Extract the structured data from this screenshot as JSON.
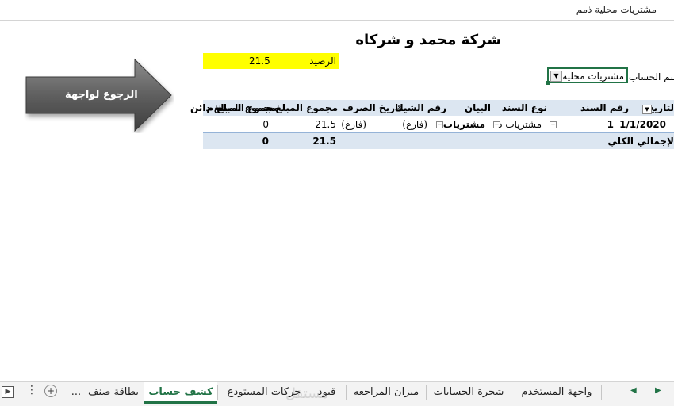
{
  "formula_bar": {
    "text": "مشتريات محلية ذمم"
  },
  "header": {
    "company_title": "شركة محمد و شركاه"
  },
  "balance": {
    "label": "الرصيد",
    "value": "21.5"
  },
  "nav_button": {
    "label": "الرجوع لواجهة"
  },
  "filter": {
    "label": "سم الحساب",
    "selected": "مشتريات محلية"
  },
  "pivot": {
    "headers": {
      "date": "لتاريخ",
      "doc_no": "رقم السند",
      "doc_type": "نوع السند",
      "statement": "البيان",
      "check_no": "رقم الشيك",
      "exchange_date": "تاريخ الصرف",
      "sum_amount": "مجموع المبلغ",
      "sum_amount_debit": "مجموع المبلغ م",
      "sum_amount_credit": "مجموع المبلغ دائن"
    },
    "row": {
      "date": "1/1/2020",
      "doc_no": "1",
      "doc_type": "مشتريات ذ",
      "statement": "مشتريات",
      "check_no": "(فارغ)",
      "exchange_date": "(فارغ)",
      "sum_amount": "21.5",
      "sum_amount_debit": "0"
    },
    "total": {
      "label": "لإجمالي الكلي",
      "sum_amount": "21.5",
      "sum_amount_debit": "0"
    }
  },
  "tabs": {
    "user_interface": "واجهة المستخدم",
    "accounts_tree": "شجرة الحسابات",
    "trial_balance": "ميزان المراجعه",
    "entries": "قيود",
    "warehouse_moves": "حركات المستودع",
    "statement": "كشف حساب",
    "item_card": "بطاقة صنف",
    "more": "...",
    "watermark": "مستقل"
  }
}
